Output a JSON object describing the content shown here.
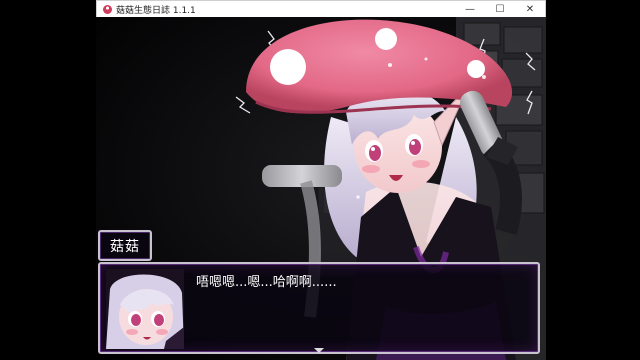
{
  "window": {
    "title": "菇菇生態日誌 1.1.1",
    "minimize_glyph": "—",
    "maximize_glyph": "☐",
    "close_glyph": "✕"
  },
  "dialogue": {
    "speaker": "菇菇",
    "text": "唔嗯嗯...嗯...哈啊啊......"
  },
  "colors": {
    "mushroom_cap": "#e8728f",
    "hair": "#d9d2ec",
    "eyes": "#c0407a",
    "window_border": "#c9c3cf",
    "window_fill": "#0a0612"
  }
}
